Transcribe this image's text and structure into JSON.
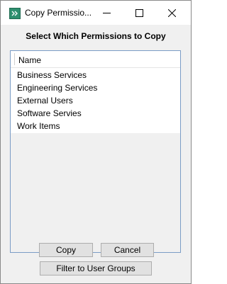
{
  "window": {
    "title": "Copy Permissio..."
  },
  "dialog": {
    "heading": "Select Which Permissions to Copy"
  },
  "list": {
    "column_header": "Name",
    "items": [
      "Business Services",
      "Engineering Services",
      "External Users",
      "Software Servies",
      "Work Items"
    ]
  },
  "buttons": {
    "copy": "Copy",
    "cancel": "Cancel",
    "filter": "Filter to User Groups"
  },
  "colors": {
    "app_icon": "#2f8f6f",
    "list_border": "#7a9cc6",
    "button_face": "#e1e1e1"
  }
}
